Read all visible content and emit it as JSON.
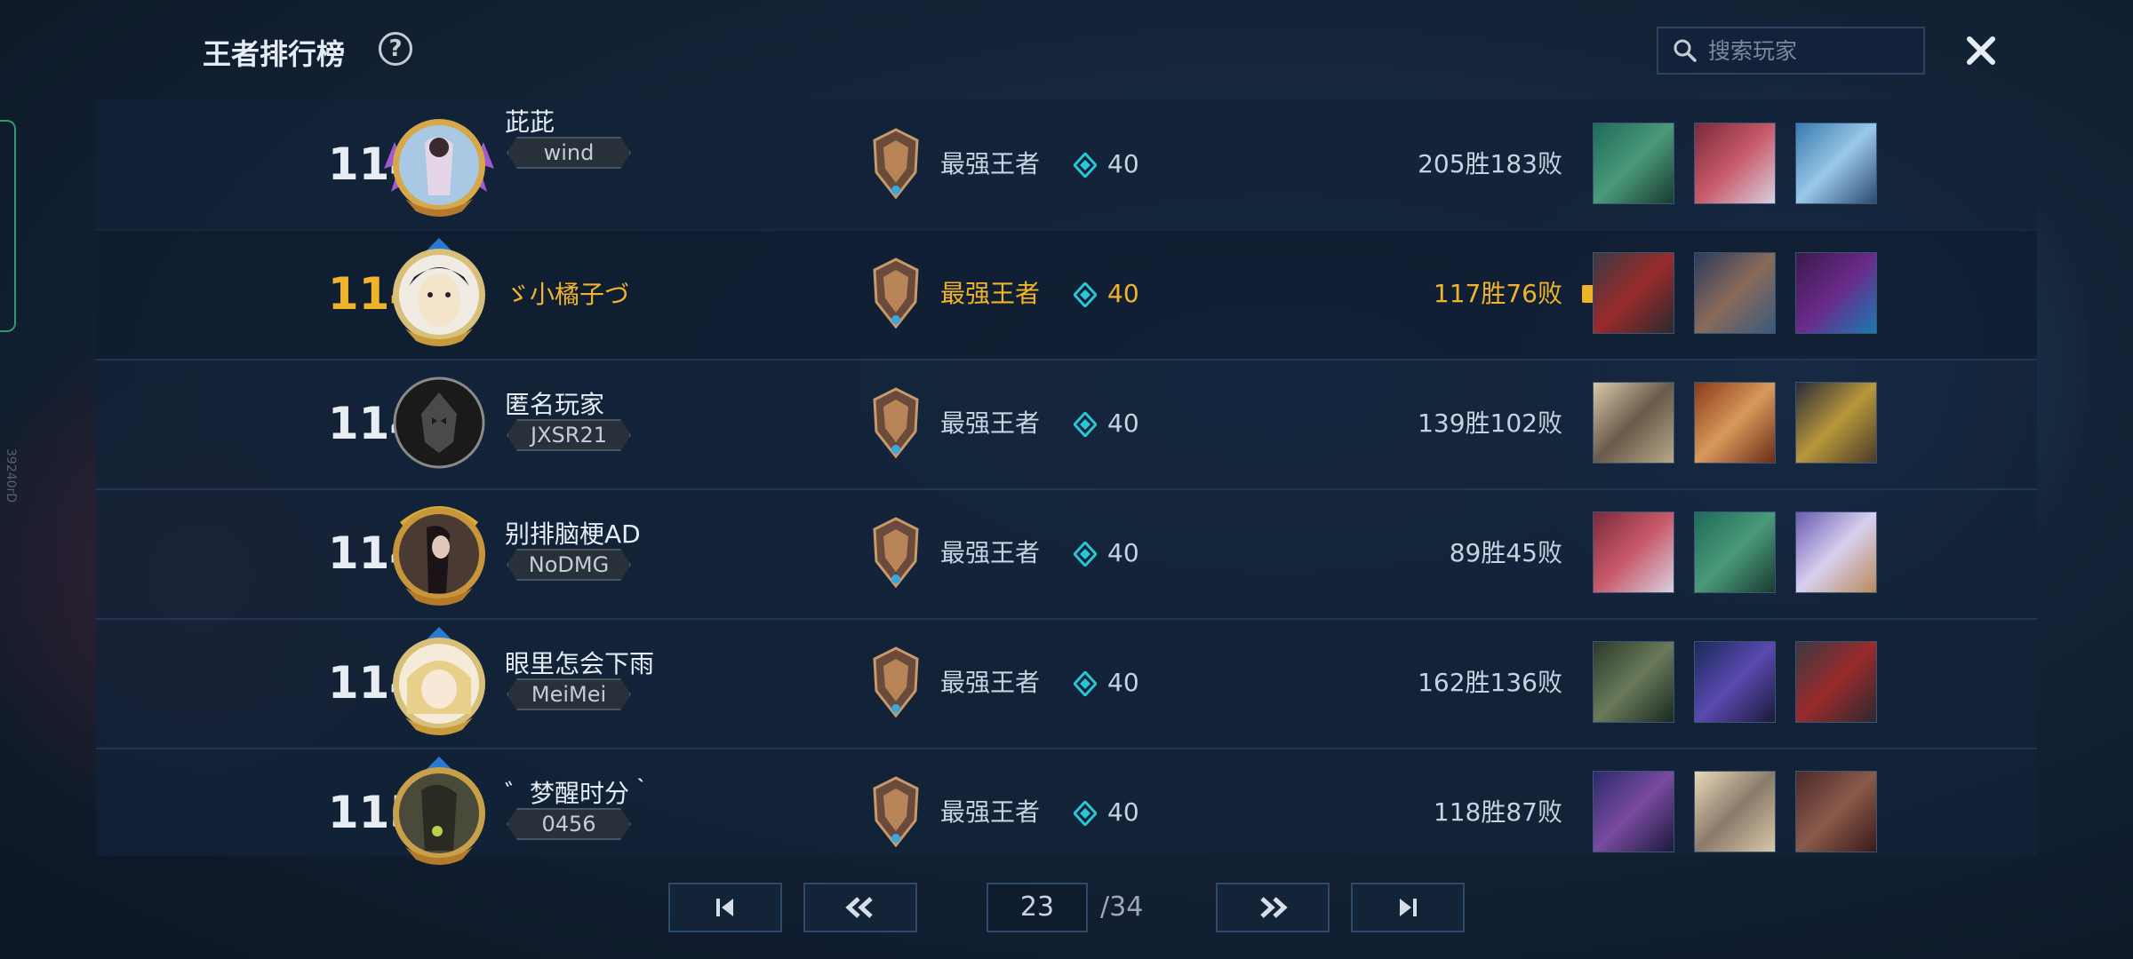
{
  "header": {
    "title": "王者排行榜",
    "help_label": "?",
    "search_placeholder": "搜索玩家",
    "close_icon": "close-icon"
  },
  "side_id": "39240rD",
  "rows": [
    {
      "rank": "1145",
      "name": "茈茈",
      "tag": "wind",
      "tier": "最强王者",
      "stars": "40",
      "record": "205胜183败",
      "self": false
    },
    {
      "rank": "1146",
      "name": "ゞ小橘子づ",
      "tag": "",
      "tier": "最强王者",
      "stars": "40",
      "record": "117胜76败",
      "self": true
    },
    {
      "rank": "1147",
      "name": "匿名玩家",
      "tag": "JXSR21",
      "tier": "最强王者",
      "stars": "40",
      "record": "139胜102败",
      "self": false
    },
    {
      "rank": "1148",
      "name": "别排脑梗AD",
      "tag": "NoDMG",
      "tier": "最强王者",
      "stars": "40",
      "record": "89胜45败",
      "self": false
    },
    {
      "rank": "1149",
      "name": "眼里怎会下雨",
      "tag": "MeiMei",
      "tier": "最强王者",
      "stars": "40",
      "record": "162胜136败",
      "self": false
    },
    {
      "rank": "1150",
      "name": "゛梦醒时分｀",
      "tag": "0456",
      "tier": "最强王者",
      "stars": "40",
      "record": "118胜87败",
      "self": false
    }
  ],
  "pagination": {
    "current": "23",
    "total": "/34",
    "first_icon": "first-page-icon",
    "prev_icon": "prev-page-icon",
    "next_icon": "next-page-icon",
    "last_icon": "last-page-icon"
  },
  "colors": {
    "accent": "#f0b42c",
    "star": "#29c7d6",
    "bg": "#142438"
  }
}
